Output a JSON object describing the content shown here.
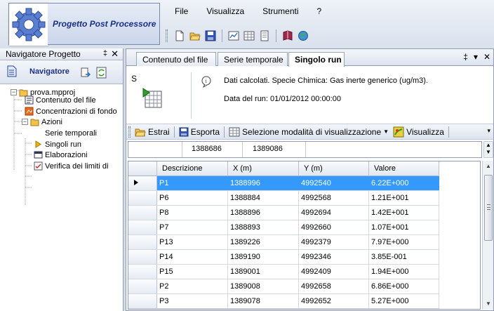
{
  "app": {
    "title": "Progetto Post Processore"
  },
  "menu": {
    "items": [
      "File",
      "Visualizza",
      "Strumenti",
      "?"
    ]
  },
  "navigator": {
    "pane_title": "Navigatore Progetto",
    "pin": "‡",
    "close": "✕",
    "toolbar_label": "Navigatore",
    "tree": {
      "root": "prova.mpproj",
      "file_content": "Contenuto del file",
      "background": "Concentrazioni di fondo",
      "actions": "Azioni",
      "time_series": "Serie temporali",
      "single_runs": "Singoli run",
      "elaborations": "Elaborazioni",
      "limit_check": "Verifica dei limiti di"
    }
  },
  "tabs": {
    "file_content": "Contenuto del file",
    "time_series": "Serie temporale",
    "single_run": "Singolo run",
    "controls": {
      "pin": "‡",
      "menu": "▾",
      "close": "✕"
    }
  },
  "info": {
    "s_label": "S",
    "line1": "Dati calcolati. Specie Chimica: Gas inerte generico (ug/m3).",
    "line2": "Data del run: 01/01/2012 00:00:00"
  },
  "toolbar": {
    "extract": "Estrai",
    "export": "Esporta",
    "mode_select": "Selezione modalità di visualizzazione",
    "visualize": "Visualizza"
  },
  "top_grid": {
    "values": [
      "1388686",
      "1389086"
    ]
  },
  "grid": {
    "columns": [
      "Descrizione",
      "X (m)",
      "Y (m)",
      "Valore"
    ],
    "rows": [
      [
        "P1",
        "1388996",
        "4992540",
        "6.22E+000"
      ],
      [
        "P6",
        "1388884",
        "4992568",
        "1.21E+001"
      ],
      [
        "P8",
        "1388896",
        "4992694",
        "1.42E+001"
      ],
      [
        "P7",
        "1388893",
        "4992660",
        "1.07E+001"
      ],
      [
        "P13",
        "1389226",
        "4992379",
        "7.97E+000"
      ],
      [
        "P14",
        "1389190",
        "4992346",
        "3.85E-001"
      ],
      [
        "P15",
        "1389001",
        "4992409",
        "1.94E+000"
      ],
      [
        "P2",
        "1389008",
        "4992658",
        "6.86E+000"
      ],
      [
        "P3",
        "1389078",
        "4992652",
        "5.27E+000"
      ]
    ],
    "selected_row": 0
  },
  "colors": {
    "selection": "#3399ff",
    "title_blue": "#1c2f86"
  }
}
